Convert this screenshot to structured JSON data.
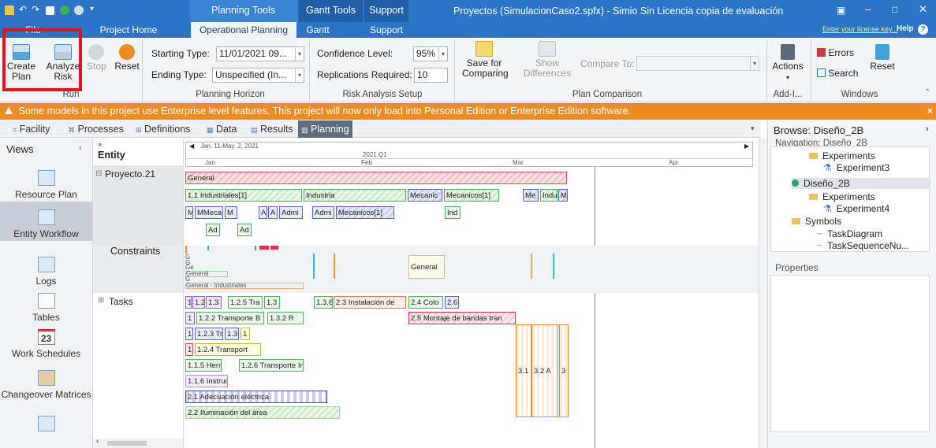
{
  "titlebar": {
    "context_groups": [
      "Planning Tools",
      "Gantt Tools",
      "Support"
    ],
    "window_title": "Proyectos (SimulacionCaso2.spfx) - Simio Sin Licencia copia de evaluación"
  },
  "tabs": [
    "File",
    "Project Home",
    "Operational Planning",
    "Gantt",
    "Support"
  ],
  "license_link": "Enter your license key...",
  "help_label": "Help",
  "ribbon": {
    "run": {
      "create_plan": "Create Plan",
      "analyze_risk": "Analyze Risk",
      "stop": "Stop",
      "reset": "Reset",
      "group_label": "Run"
    },
    "horizon": {
      "starting_label": "Starting Type:",
      "starting_value": "11/01/2021 09...",
      "ending_label": "Ending Type:",
      "ending_value": "Unspecified (In...",
      "group_label": "Planning Horizon"
    },
    "risk": {
      "confidence_label": "Confidence Level:",
      "confidence_value": "95%",
      "replications_label": "Replications Required:",
      "replications_value": "10",
      "group_label": "Risk Analysis Setup"
    },
    "comparison": {
      "save_label": "Save for Comparing",
      "show_label": "Show Differences",
      "compare_label": "Compare To:",
      "group_label": "Plan Comparison"
    },
    "addin": {
      "actions": "Actions",
      "group_label": "Add-I..."
    },
    "windows": {
      "errors": "Errors",
      "search": "Search",
      "reset": "Reset",
      "group_label": "Windows"
    }
  },
  "warning": "Some models in this project use Enterprise level features. This project will now only load into Personal Edition or Enterprise Edition software.",
  "view_tabs": [
    "Facility",
    "Processes",
    "Definitions",
    "Data",
    "Results",
    "Planning"
  ],
  "views_panel": {
    "title": "Views",
    "items": [
      "Resource Plan",
      "Entity Workflow",
      "Logs",
      "Tables",
      "Work Schedules",
      "Changeover Matrices"
    ],
    "work_schedules_number": "23"
  },
  "entity": {
    "header": "Entity",
    "proyecto": "Proyecto.21",
    "constraints": "Constraints",
    "tasks": "Tasks"
  },
  "timeline": {
    "range": "Jan. 11-May. 2, 2021",
    "quarter": "2021 Q1",
    "months": [
      "Jan",
      "Feb",
      "Mar",
      "Apr"
    ]
  },
  "gantt_labels": {
    "general": "General",
    "row2": [
      "1.1 Industriales[1]",
      "Industria",
      "Mecanic",
      "Mecanicos[1]",
      "Me",
      "Indust",
      "M"
    ],
    "row3": [
      "M",
      "MMeca",
      "M",
      "A",
      "A",
      "Admi",
      "Admi",
      "Mecanicos[1]",
      "Ind"
    ],
    "row4": [
      "Ad",
      "Ad"
    ],
    "constraints": [
      "G",
      "G",
      "Ge",
      "General",
      "G",
      "General - Industriales",
      "General"
    ],
    "task_rows": [
      [
        "1",
        "1.2",
        "1.3",
        "1.2.5 Tra",
        "1.3",
        "1.3.6",
        "2.3 Instalación de",
        "2.4 Colo",
        "2.6"
      ],
      [
        "1",
        "1.2.2 Transporte B",
        "1.3.2 R",
        "2.5 Montaje de bandas tran"
      ],
      [
        "1.1",
        "1.2.3 Tra",
        "1.3",
        "1"
      ],
      [
        "1",
        "1.2.4 Transport"
      ],
      [
        "1.1.5 Herr",
        "1.2.6 Transporte In",
        "3.1",
        "3.2 A",
        "3"
      ],
      [
        "1.1.6 Instrum"
      ],
      [
        "2.1 Adecuación eléctrica"
      ],
      [
        "2.2 Iluminación del área"
      ]
    ]
  },
  "browse": {
    "title": "Browse: Diseño_2B",
    "navigation": "Navigation: Diseño_2B",
    "tree": [
      "Experiments",
      "Experiment3",
      "Diseño_2B",
      "Experiments",
      "Experiment4",
      "Symbols",
      "TaskDiagram",
      "TaskSequenceNu..."
    ],
    "properties": "Properties"
  }
}
